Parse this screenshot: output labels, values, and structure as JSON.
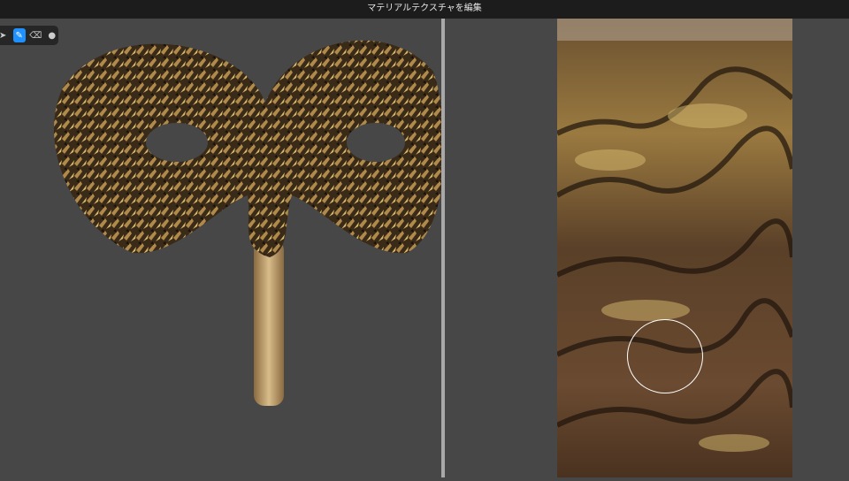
{
  "title": "マテリアルテクスチャを編集",
  "toolbar": {
    "tools": [
      {
        "name": "select-tool",
        "icon": "arrow-icon"
      },
      {
        "name": "brush-tool",
        "icon": "brush-icon",
        "active": true
      },
      {
        "name": "eraser-tool",
        "icon": "eraser-icon"
      },
      {
        "name": "fill-tool",
        "icon": "drop-icon"
      }
    ],
    "accent": "#1e90ff"
  }
}
